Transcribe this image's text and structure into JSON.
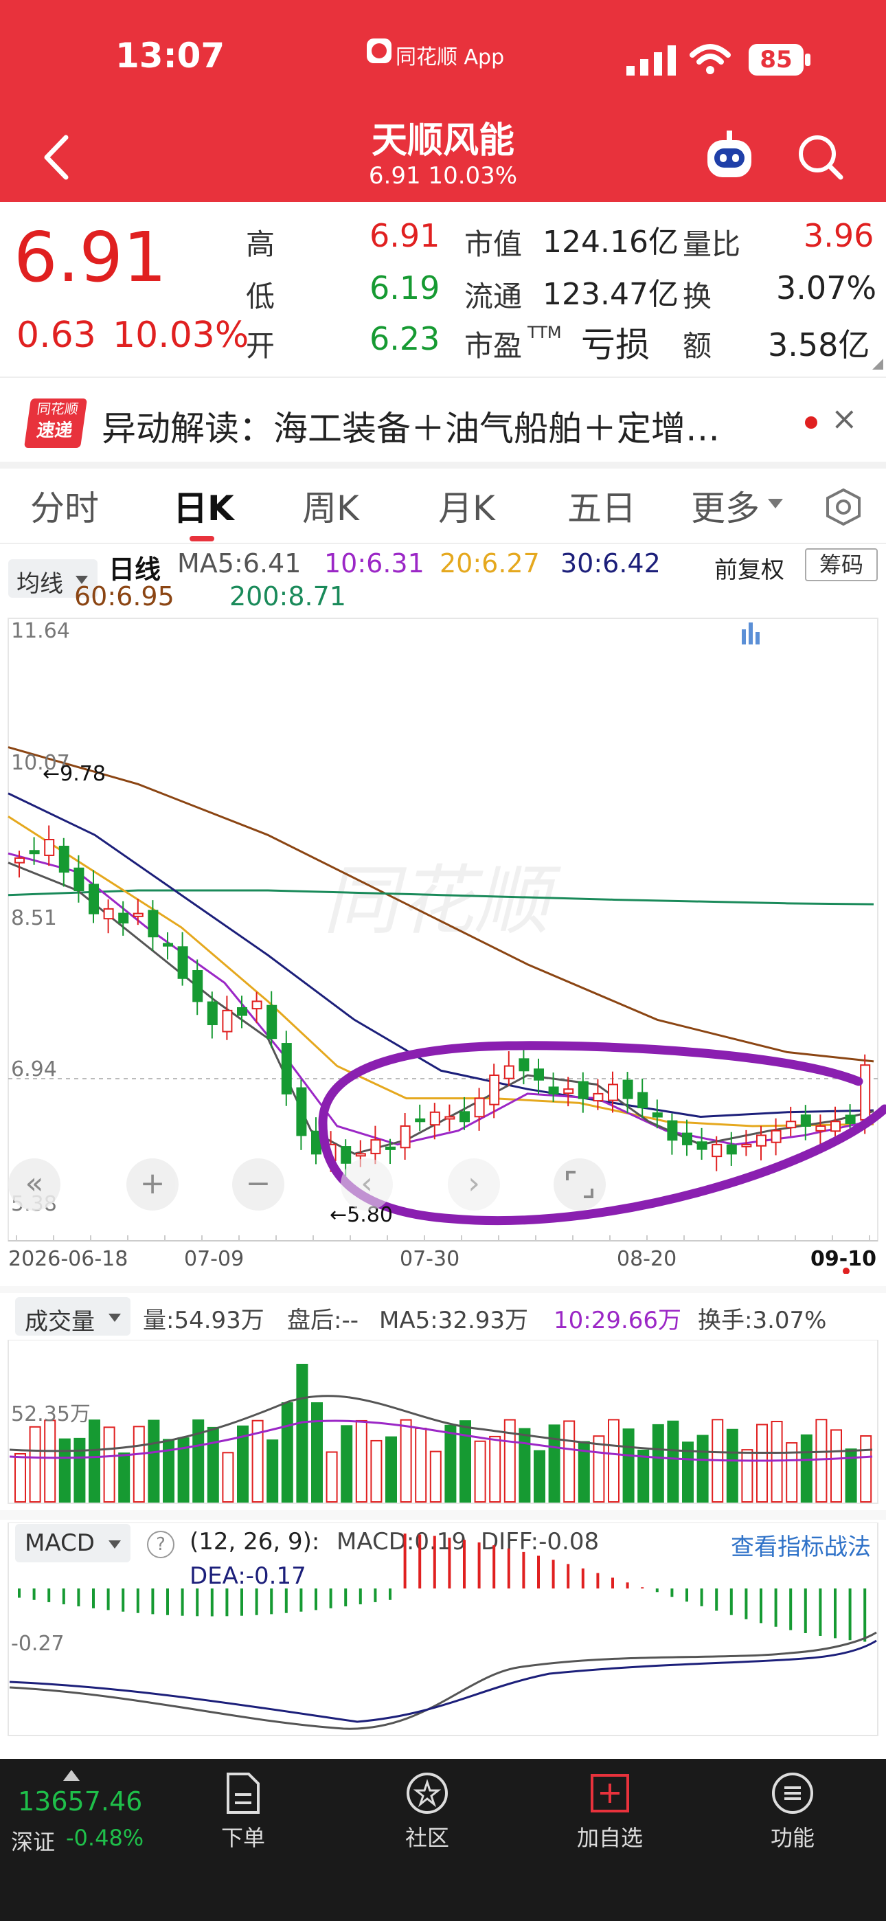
{
  "status": {
    "time": "13:07",
    "app_name": "同花顺 App",
    "battery": "85"
  },
  "header": {
    "back": "‹",
    "title": "天顺风能",
    "subtitle": "6.91 10.03%"
  },
  "quote": {
    "price": "6.91",
    "change": "0.63",
    "change_pct": "10.03%",
    "high_label": "高",
    "high": "6.91",
    "low_label": "低",
    "low": "6.19",
    "open_label": "开",
    "open": "6.23",
    "mcap_label": "市值",
    "mcap": "124.16亿",
    "float_label": "流通",
    "float": "123.47亿",
    "pe_label": "市盈",
    "pe_suffix": "TTM",
    "pe": "亏损",
    "vr_label": "量比",
    "vr": "3.96",
    "turnover_label": "换",
    "turnover": "3.07%",
    "amount_label": "额",
    "amount": "3.58亿"
  },
  "news": {
    "badge_top": "同花顺",
    "badge_bottom": "速递",
    "text": "异动解读：海工装备＋油气船舶＋定增…",
    "close": "×"
  },
  "tabs": [
    {
      "label": "分时"
    },
    {
      "label": "日K"
    },
    {
      "label": "周K"
    },
    {
      "label": "月K"
    },
    {
      "label": "五日"
    },
    {
      "label": "更多"
    }
  ],
  "kline": {
    "ma_select": "均线",
    "period_label": "日线",
    "ma5": "MA5:6.41",
    "ma10": "10:6.31",
    "ma20": "20:6.27",
    "ma30": "30:6.42",
    "ma60": "60:6.95",
    "ma200": "200:8.71",
    "adjust": "前复权",
    "chip": "筹码",
    "y_labels": [
      "11.64",
      "10.07",
      "8.51",
      "6.94",
      "5.38"
    ],
    "marker_high": "←9.78",
    "marker_low": "←5.80",
    "x_labels": [
      "2026-06-18",
      "07-09",
      "07-30",
      "08-20",
      "09-10"
    ],
    "watermark": "同花顺"
  },
  "volume": {
    "select": "成交量",
    "vol": "量:54.93万",
    "after": "盘后:--",
    "ma5": "MA5:32.93万",
    "ma10": "10:29.66万",
    "turnover": "换手:3.07%",
    "y_label": "52.35万"
  },
  "macd": {
    "select": "MACD",
    "help": "?",
    "params": "(12, 26, 9):",
    "macd": "MACD:0.19",
    "diff": "DIFF:-0.08",
    "dea": "DEA:-0.17",
    "link": "查看指标战法",
    "y_label": "-0.27"
  },
  "bottom": {
    "index_value": "13657.46",
    "index_name": "深证",
    "index_change": "-0.48%",
    "items": [
      {
        "label": "下单"
      },
      {
        "label": "社区"
      },
      {
        "label": "加自选"
      },
      {
        "label": "功能"
      }
    ]
  },
  "colors": {
    "brand_red": "#e8323c",
    "up": "#e02020",
    "down": "#169a32",
    "ma5": "#555555",
    "ma10": "#9b27c6",
    "ma20": "#e5a81e",
    "ma30": "#1c1f7a",
    "ma60": "#8b4513",
    "ma200": "#1a8a5a",
    "annotation": "#8a1fb0"
  }
}
